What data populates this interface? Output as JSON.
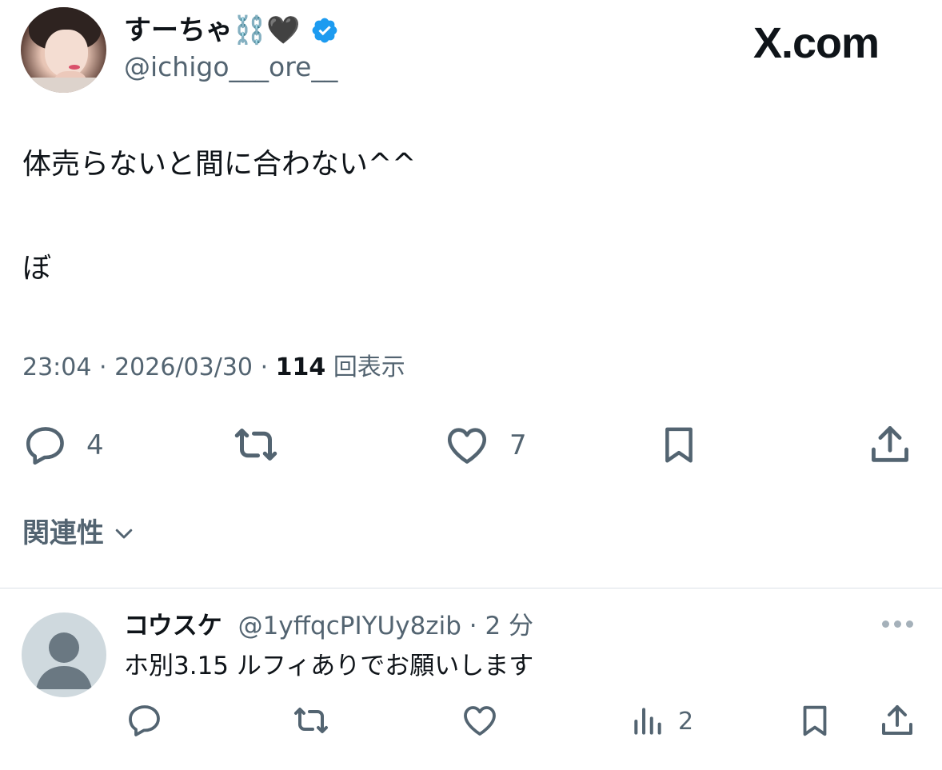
{
  "tweet": {
    "author": {
      "display_name": "すーちゃ⛓️🖤",
      "handle": "@ichigo___ore__",
      "verified": true
    },
    "site_logo": "X.com",
    "text_lines": [
      "体売らないと間に合わない^^",
      "ぼ"
    ],
    "time": "23:04",
    "date": "2026/03/30",
    "views_count": "114",
    "views_label": "回表示",
    "actions": {
      "reply_count": "4",
      "retweet_count": "",
      "like_count": "7"
    },
    "related_label": "関連性"
  },
  "reply": {
    "display_name": "コウスケ",
    "handle": "@1yffqcPIYUy8zib",
    "time_ago": "2 分",
    "text": "ホ別3.15 ルフィありでお願いします",
    "views_count": "2"
  },
  "colors": {
    "text_primary": "#0f1419",
    "text_secondary": "#536471",
    "verified_blue": "#1d9bf0",
    "divider": "#dbe1e6"
  },
  "icons": {
    "verified": "verified-badge-icon",
    "reply": "reply-icon",
    "retweet": "retweet-icon",
    "like": "heart-icon",
    "bookmark": "bookmark-icon",
    "share": "share-icon",
    "views": "views-chart-icon",
    "chevron": "chevron-down-icon",
    "more": "more-dots-icon"
  }
}
